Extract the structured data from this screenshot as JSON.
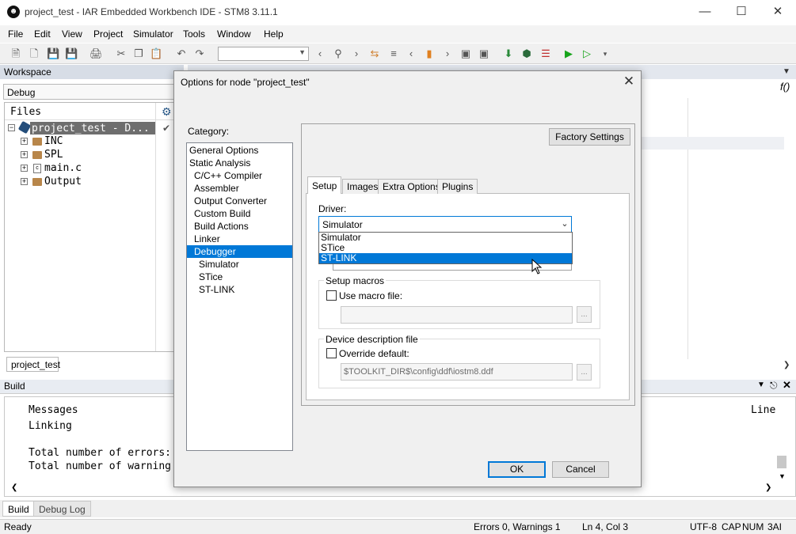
{
  "window": {
    "title": "project_test - IAR Embedded Workbench IDE - STM8 3.11.1"
  },
  "menu": [
    "File",
    "Edit",
    "View",
    "Project",
    "Simulator",
    "Tools",
    "Window",
    "Help"
  ],
  "workspace": {
    "title": "Workspace",
    "config": "Debug",
    "files_header": "Files",
    "project_label": "project_test - D...",
    "items": [
      "INC",
      "SPL",
      "main.c",
      "Output"
    ],
    "tab": "project_test"
  },
  "build": {
    "title": "Build",
    "col_messages": "Messages",
    "col_line": "Line",
    "lines": [
      "Linking",
      "",
      "Total number of errors:",
      "Total number of warning"
    ],
    "tabs": [
      "Build",
      "Debug Log"
    ]
  },
  "status": {
    "ready": "Ready",
    "errors": "Errors 0, Warnings 1",
    "position": "Ln 4, Col 3",
    "encoding": "UTF-8",
    "cap": "CAP",
    "num": "NUM",
    "ovr": "3AI"
  },
  "dialog": {
    "title": "Options for node \"project_test\"",
    "category_label": "Category:",
    "categories": [
      "General Options",
      "Static Analysis",
      "C/C++ Compiler",
      "Assembler",
      "Output Converter",
      "Custom Build",
      "Build Actions",
      "Linker",
      "Debugger",
      "Simulator",
      "STice",
      "ST-LINK"
    ],
    "selected_category": "Debugger",
    "factory_settings": "Factory Settings",
    "tabs": [
      "Setup",
      "Images",
      "Extra Options",
      "Plugins"
    ],
    "driver_label": "Driver:",
    "driver_value": "Simulator",
    "driver_options": [
      "Simulator",
      "STice",
      "ST-LINK"
    ],
    "setup_macros": {
      "legend": "Setup macros",
      "checkbox": "Use macro file:",
      "path": ""
    },
    "device_desc": {
      "legend": "Device description file",
      "checkbox": "Override default:",
      "path": "$TOOLKIT_DIR$\\config\\ddf\\iostm8.ddf"
    },
    "ellipsis": "...",
    "ok": "OK",
    "cancel": "Cancel"
  }
}
